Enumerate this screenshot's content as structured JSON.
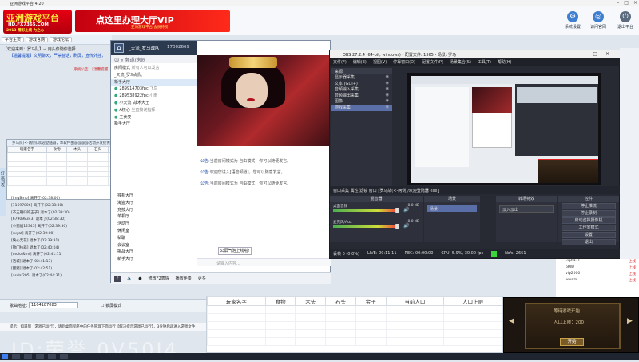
{
  "window_title": "亚洲游戏平台 4.20",
  "logo": {
    "line1": "亚洲游戏平台",
    "line2": "HD.FX7365.COM",
    "line3": "2013 精彩上线 为之心"
  },
  "banner": {
    "text": "点这里办理大厅VIP",
    "sub": "亚洲游戏平台 会员特权"
  },
  "top_buttons": [
    {
      "label": "系统设置",
      "icon": "gear-icon"
    },
    {
      "label": "访问官网",
      "icon": "globe-icon"
    },
    {
      "label": "退出平台",
      "icon": "exit-icon"
    }
  ],
  "nav": [
    "平台主页",
    "游戏官网",
    "游戏论坛"
  ],
  "notices": {
    "line1": "【欢迎来到：罗马队】→ 用头像随你选择",
    "line2": "【温馨提醒】文明聊天，严禁脏话，刷屏，宣传外挂，",
    "line3": "【系统公告】【温馨提醒"
  },
  "side_tab": "好友列表",
  "chat": {
    "room_name": "_天流_罗马战队",
    "room_id": "17002669",
    "search_label": "频道/房间",
    "members": [
      {
        "name": "房间模式",
        "note": "所有人可以发言"
      },
      {
        "name": "_天流_罗马战队",
        "note": ""
      },
      {
        "name": "新手大厅",
        "note": ""
      },
      {
        "name": "289914703fpc",
        "note": "飞鸟"
      },
      {
        "name": "289538922fpc",
        "note": "小雨"
      },
      {
        "name": "小天流_战术大王",
        "note": ""
      },
      {
        "name": "A核心",
        "note": "坐直接说指挥"
      },
      {
        "name": "主食麦",
        "note": ""
      },
      {
        "name": "新手大厅",
        "note": ""
      }
    ],
    "channels": [
      "独机大厅",
      "海盗大厅",
      "竞技大厅",
      "单机厅",
      "活动厅",
      "休闲室",
      "私聊",
      "会议室",
      "挑战大厅",
      "新手大厅"
    ],
    "messages": [
      {
        "prefix": "公告:",
        "text": "当前房间模式为 自由模式，你可以随便发言。"
      },
      {
        "prefix": "公告:",
        "text": "欢迎您进入[语音频道]，您可以随意发言。"
      },
      {
        "prefix": "公告:",
        "text": "当前房间模式为 自由模式，你可以随便发言。"
      }
    ],
    "public_button": "公屏气泡上线啦!",
    "input_placeholder": "请输入内容...",
    "bottom_items": [
      "修改F2表情",
      "播放伴奏",
      "更多"
    ]
  },
  "table_window": {
    "title": "罗马队(<-两侧)/欢迎登陆器，本软件由@@@@活动开发提供运行。QQ：4107123801(跟我们连线)",
    "columns": [
      "玩家名字",
      "食物",
      "木头",
      "石头",
      "金子",
      "当前人口",
      "人口上限"
    ]
  },
  "log_entries": [
    "[ImgBmp] 离开了(02:38:00)",
    "[11697806] 离开了(02:38:30)",
    "[不王朝归的王子] 退本了(02:38:30)",
    "[679098343] 退本了(02:38:30)",
    "[小猪姐12345] 离开了(02:39:30)",
    "[sxyaf] 离开了(02:39:00)",
    "[快心无花] 退本了(02:39:31)",
    "[敬门扶器] 退本了(02:40:04)",
    "[moloi&mt] 离开了(02:41:11)",
    "[活城] 退本了(02:41:13)",
    "[猪猪] 退本了(02:42:51)",
    "[asdaf205] 退本了(02:44:31)"
  ],
  "input_row": {
    "label": "歌曲地址：",
    "value": "1104187083",
    "checkbox_label": "锁屏模式"
  },
  "tip_text": "提示：如遇到【游戏已运行】，请到桌面程序中的任务管理下面运行【解决提示游戏已运行】，3分钟后再进入游戏文件",
  "obs": {
    "title": "OBS 27.2.4 (64-bit, windows) - 配置文件: 1565 - 场景: 罗马",
    "menu": [
      "文件(F)",
      "编辑(E)",
      "视图(V)",
      "停靠窗口(D)",
      "配置文件(P)",
      "场景集合(S)",
      "工具(T)",
      "帮助(H)"
    ],
    "sources_header": "来源",
    "sources": [
      "显示器采集",
      "文本 (GDI+)",
      "音频输入采集",
      "音频输出采集",
      "图像",
      "游戏采集"
    ],
    "scene_label": "窗口采集",
    "scene_item": "场景",
    "mid_text": "窗口采集     属性     滤镜     窗口     [罗马战(<-两侧)/欢迎登陆器 exe]",
    "mixer_header": "混音器",
    "mixer_tracks": [
      {
        "name": "桌面音频",
        "level": "0.0 dB"
      },
      {
        "name": "麦克风/Aux",
        "level": "0.0 dB"
      },
      {
        "name": "音频输入采集",
        "level": "0.0 dB"
      }
    ],
    "scenes_header": "场景",
    "transitions_header": "转场特效",
    "transition_value": "淡入淡出",
    "controls_header": "控件",
    "controls": [
      "停止推流",
      "停止录制",
      "启动虚拟摄像机",
      "工作室模式",
      "设置",
      "退出"
    ],
    "status": {
      "dropped": "丢帧 0 (0.0%)",
      "live": "LIVE: 00:11:11",
      "rec": "REC: 00:00:00",
      "cpu": "CPU: 5.9%, 30.00 fps",
      "kbps": "kb/s: 2661"
    }
  },
  "right_list": [
    {
      "name": "vip0971",
      "status": "上线"
    },
    {
      "name": "6KW",
      "status": "上线"
    },
    {
      "name": "vip2000",
      "status": "上线"
    },
    {
      "name": "wwsm",
      "status": "上线"
    }
  ],
  "big_table": {
    "columns": [
      "玩家名字",
      "食物",
      "木头",
      "石头",
      "金子",
      "当前人口",
      "人口上限"
    ]
  },
  "game": {
    "title": "等待游戏开始...",
    "count_label": "人口上限：",
    "count": "200",
    "button": "开始"
  },
  "watermark": "ID:荣誉 0V50J4",
  "taskbar_items": [
    "开始"
  ]
}
